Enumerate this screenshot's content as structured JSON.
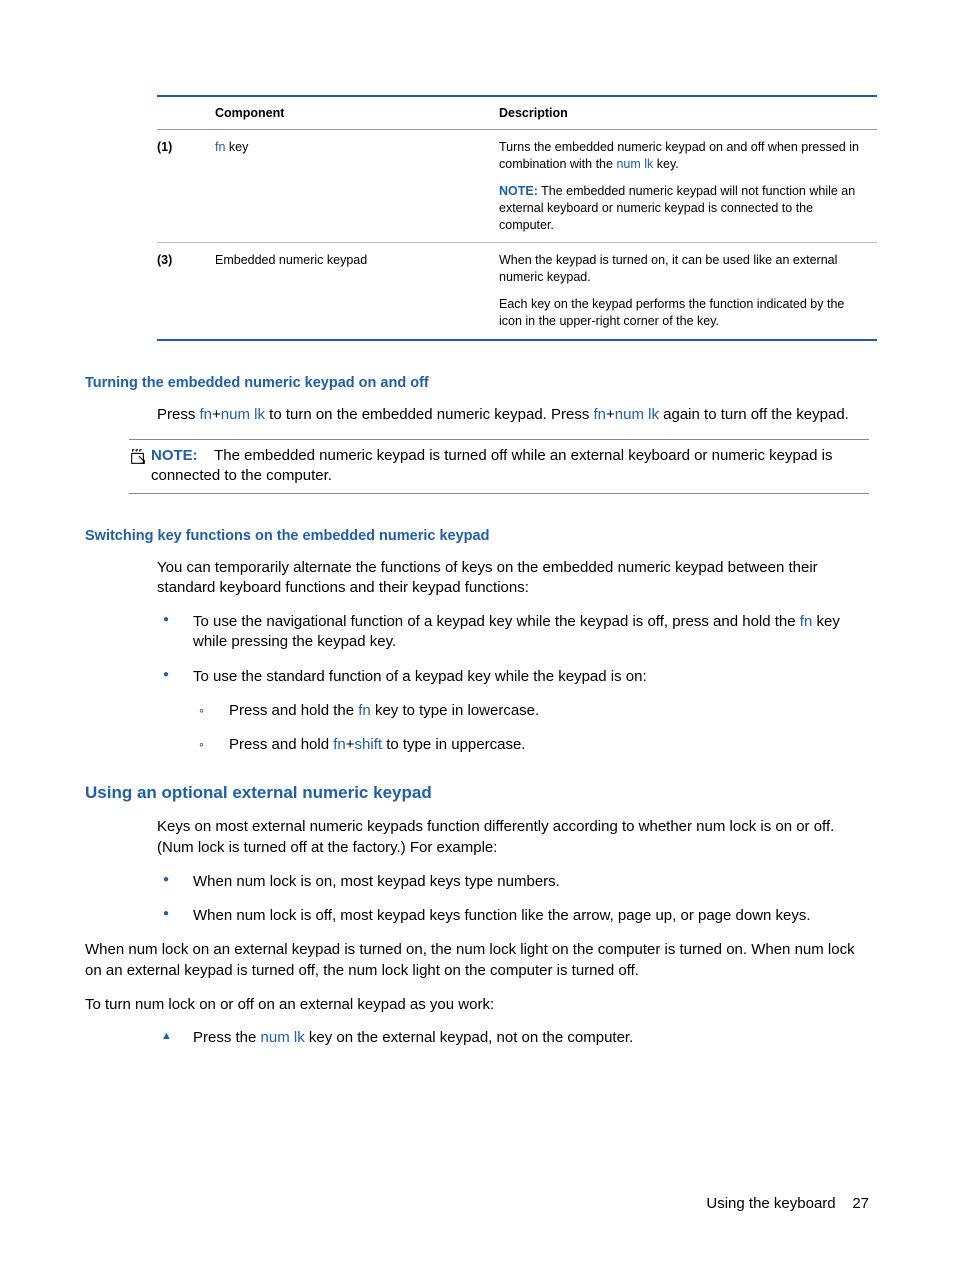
{
  "table": {
    "headers": {
      "component": "Component",
      "description": "Description"
    },
    "rows": [
      {
        "num": "(1)",
        "comp_key": "fn",
        "comp_rest": " key",
        "desc1a": "Turns the embedded numeric keypad on and off when pressed in combination with the ",
        "desc1_key": "num lk",
        "desc1b": " key.",
        "note_label": "NOTE:",
        "note_text": "   The embedded numeric keypad will not function while an external keyboard or numeric keypad is connected to the computer."
      },
      {
        "num": "(3)",
        "comp": "Embedded numeric keypad",
        "desc1": "When the keypad is turned on, it can be used like an external numeric keypad.",
        "desc2": "Each key on the keypad performs the function indicated by the icon in the upper-right corner of the key."
      }
    ]
  },
  "section1": {
    "heading": "Turning the embedded numeric keypad on and off",
    "p1a": "Press ",
    "p1k1": "fn",
    "p1plus1": "+",
    "p1k2": "num lk",
    "p1b": " to turn on the embedded numeric keypad. Press ",
    "p1k3": "fn",
    "p1plus2": "+",
    "p1k4": "num lk",
    "p1c": " again to turn off the keypad.",
    "note_label": "NOTE:",
    "note_text": " The embedded numeric keypad is turned off while an external keyboard or numeric keypad is connected to the computer."
  },
  "section2": {
    "heading": "Switching key functions on the embedded numeric keypad",
    "intro": "You can temporarily alternate the functions of keys on the embedded numeric keypad between their standard keyboard functions and their keypad functions:",
    "b1a": "To use the navigational function of a keypad key while the keypad is off, press and hold the ",
    "b1k": "fn",
    "b1b": " key while pressing the keypad key.",
    "b2": "To use the standard function of a keypad key while the keypad is on:",
    "s1a": "Press and hold the ",
    "s1k": "fn",
    "s1b": " key to type in lowercase.",
    "s2a": "Press and hold ",
    "s2k1": "fn",
    "s2plus": "+",
    "s2k2": "shift",
    "s2b": " to type in uppercase."
  },
  "section3": {
    "heading": "Using an optional external numeric keypad",
    "p1": "Keys on most external numeric keypads function differently according to whether num lock is on or off. (Num lock is turned off at the factory.) For example:",
    "b1": "When num lock is on, most keypad keys type numbers.",
    "b2": "When num lock is off, most keypad keys function like the arrow, page up, or page down keys.",
    "p2": "When num lock on an external keypad is turned on, the num lock light on the computer is turned on. When num lock on an external keypad is turned off, the num lock light on the computer is turned off.",
    "p3": "To turn num lock on or off on an external keypad as you work:",
    "t1a": "Press the ",
    "t1k": "num lk",
    "t1b": " key on the external keypad, not on the computer."
  },
  "footer": {
    "text": "Using the keyboard",
    "page": "27"
  }
}
